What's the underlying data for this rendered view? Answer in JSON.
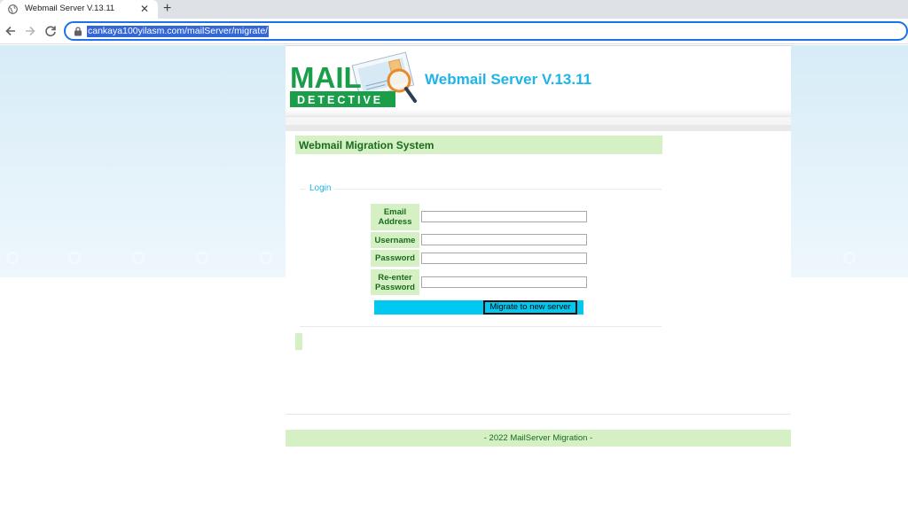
{
  "browser": {
    "tab_title": "Webmail Server V.13.11",
    "tab_close": "✕",
    "new_tab": "+",
    "url": "cankaya100yilasm.com/mailServer/migrate/",
    "icons": [
      "globe-icon",
      "close-icon",
      "plus-icon",
      "back-icon",
      "forward-icon",
      "reload-icon",
      "lock-icon"
    ]
  },
  "header": {
    "logo_text_top": "MAIL",
    "logo_text_bottom": "DETECTIVE",
    "site_title": "Webmail Server V.13.11"
  },
  "main": {
    "page_title": "Webmail Migration System",
    "legend": "Login",
    "fields": [
      {
        "label": "Email Address",
        "value": ""
      },
      {
        "label": "Username",
        "value": ""
      },
      {
        "label": "Password",
        "value": ""
      },
      {
        "label": "Re-enter Password",
        "value": ""
      }
    ],
    "submit_label": "Migrate to new server"
  },
  "footer": {
    "text": "- 2022 MailServer Migration -"
  },
  "colors": {
    "accent_blue": "#1eb4e9",
    "label_green_bg": "#d6f0c6",
    "label_green_text": "#1a6b1a",
    "button_cyan": "#00c8f0",
    "logo_green": "#1a9e4a"
  }
}
